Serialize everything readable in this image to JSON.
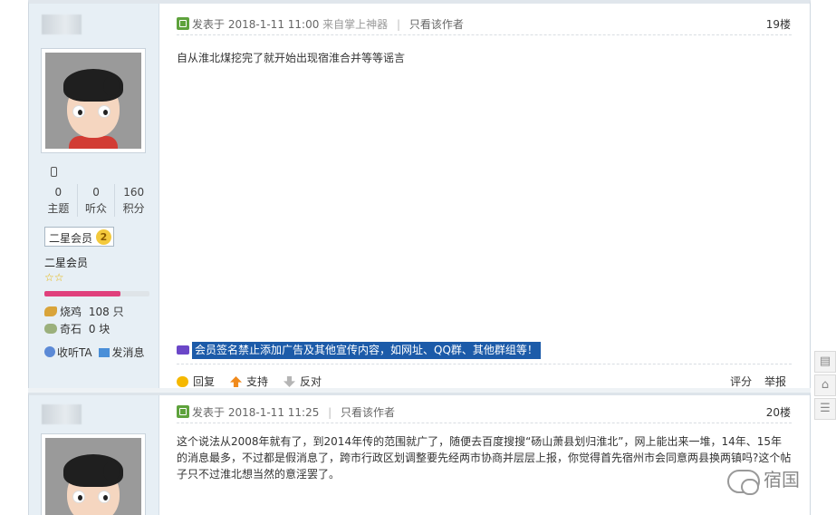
{
  "posts": [
    {
      "posted_label": "发表于",
      "date": "2018-1-11 11:00",
      "source": "来自掌上神器",
      "only_author": "只看该作者",
      "floor": "19楼",
      "message": "自从淮北煤挖完了就开始出现宿淮合并等等谣言",
      "signature": "会员签名禁止添加广告及其他宣传内容，如网址、QQ群、其他群组等！",
      "user": {
        "stats": [
          {
            "value": "0",
            "label": "主题"
          },
          {
            "value": "0",
            "label": "听众"
          },
          {
            "value": "160",
            "label": "积分"
          }
        ],
        "badge": "二星会员",
        "badge_level": "2",
        "rank": "二星会员",
        "rank_stars": "☆☆",
        "progress": 0.72,
        "currency": [
          {
            "label": "烧鸡",
            "value": "108 只",
            "icon": "chicken-icon"
          },
          {
            "label": "奇石",
            "value": "0 块",
            "icon": "stone-icon"
          }
        ],
        "follow_label": "收听TA",
        "message_label": "发消息"
      },
      "actions": {
        "reply": "回复",
        "support": "支持",
        "oppose": "反对",
        "rate": "评分",
        "report": "举报"
      }
    },
    {
      "posted_label": "发表于",
      "date": "2018-1-11 11:25",
      "only_author": "只看该作者",
      "floor": "20楼",
      "message": "这个说法从2008年就有了，到2014年传的范围就广了，随便去百度搜搜“砀山萧县划归淮北”，网上能出来一堆，14年、15年的消息最多，不过都是假消息了，跨市行政区划调整要先经两市协商并层层上报，你觉得首先宿州市会同意两县换两镇吗?这个帖子只不过淮北想当然的意淫罢了。"
    }
  ],
  "watermark": "宿国",
  "colors": {
    "sidebar": "#e7eff5",
    "signature_bg": "#1c5ba9",
    "progress": "#e0407c"
  },
  "side_tools": [
    "comment-icon",
    "back-to-top-icon",
    "list-icon"
  ]
}
